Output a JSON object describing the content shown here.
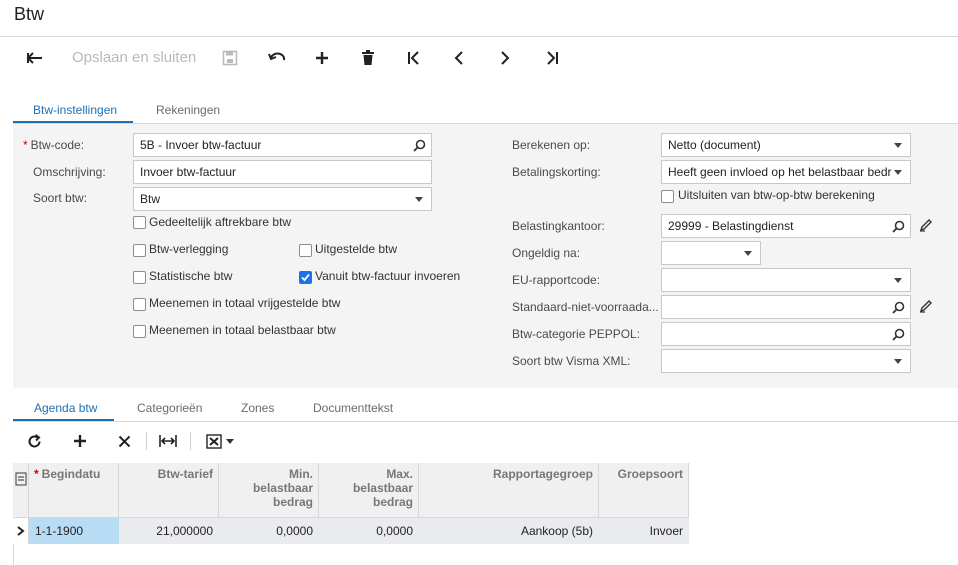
{
  "window": {
    "title": "Btw"
  },
  "toolbar": {
    "save_close_label": "Opslaan en sluiten"
  },
  "tabs": [
    {
      "label": "Btw-instellingen"
    },
    {
      "label": "Rekeningen"
    }
  ],
  "form": {
    "btw_code": {
      "label": "Btw-code:",
      "required_mark": "*",
      "value": "5B - Invoer btw-factuur"
    },
    "omschrijving": {
      "label": "Omschrijving:",
      "value": "Invoer btw-factuur"
    },
    "soort_btw": {
      "label": "Soort btw:",
      "value": "Btw"
    },
    "checkboxes": {
      "gedeeltelijk": {
        "label": "Gedeeltelijk aftrekbare btw",
        "checked": false
      },
      "verlegging": {
        "label": "Btw-verlegging",
        "checked": false
      },
      "uitgestelde": {
        "label": "Uitgestelde btw",
        "checked": false
      },
      "statistische": {
        "label": "Statistische btw",
        "checked": false
      },
      "vanuit_factuur": {
        "label": "Vanuit btw-factuur invoeren",
        "checked": true
      },
      "vrijgestelde": {
        "label": "Meenemen in totaal vrijgestelde btw",
        "checked": false
      },
      "belastbaar": {
        "label": "Meenemen in totaal belastbaar btw",
        "checked": false
      },
      "uitsluiten": {
        "label": "Uitsluiten van btw-op-btw berekening",
        "checked": false
      }
    },
    "berekenen_op": {
      "label": "Berekenen op:",
      "value": "Netto (document)"
    },
    "betalingskorting": {
      "label": "Betalingskorting:",
      "value": "Heeft geen invloed op het belastbaar bedr"
    },
    "belastingkantoor": {
      "label": "Belastingkantoor:",
      "value": "29999 - Belastingdienst"
    },
    "ongeldig_na": {
      "label": "Ongeldig na:",
      "value": ""
    },
    "eu_rapportcode": {
      "label": "EU-rapportcode:",
      "value": ""
    },
    "standaard_niet_voorraad": {
      "label": "Standaard-niet-voorraada...",
      "value": ""
    },
    "btw_categorie_peppol": {
      "label": "Btw-categorie PEPPOL:",
      "value": ""
    },
    "soort_btw_visma": {
      "label": "Soort btw Visma XML:",
      "value": ""
    }
  },
  "subtabs": [
    {
      "label": "Agenda btw"
    },
    {
      "label": "Categorieën"
    },
    {
      "label": "Zones"
    },
    {
      "label": "Documenttekst"
    }
  ],
  "grid": {
    "columns": [
      {
        "label": "Begindatu",
        "required_mark": "*"
      },
      {
        "label": "Btw-tarief"
      },
      {
        "label": "Min. belastbaar bedrag"
      },
      {
        "label": "Max. belastbaar bedrag"
      },
      {
        "label": "Rapportagegroep"
      },
      {
        "label": "Groepsoort"
      }
    ],
    "rows": [
      {
        "begindatum": "1-1-1900",
        "tarief": "21,000000",
        "min": "0,0000",
        "max": "0,0000",
        "groep": "Aankoop (5b)",
        "soort": "Invoer"
      }
    ]
  },
  "icons": [
    "back-arrow-icon",
    "save-icon",
    "undo-icon",
    "add-icon",
    "delete-icon",
    "first-page-icon",
    "prev-page-icon",
    "next-page-icon",
    "last-page-icon",
    "search-icon",
    "chevron-down-icon",
    "pencil-icon",
    "refresh-icon",
    "close-icon",
    "fit-columns-icon",
    "excel-export-icon",
    "row-select-icon",
    "row-indicator-icon"
  ],
  "colors": {
    "accent": "#1f6fb5",
    "checkbox_checked": "#1a73e8",
    "selected_cell": "#b9dcf5"
  }
}
